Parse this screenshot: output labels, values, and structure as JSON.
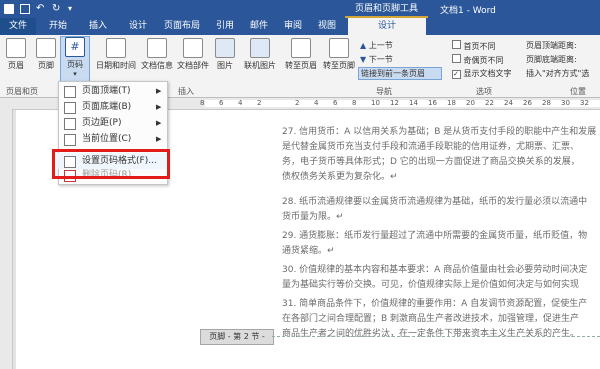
{
  "window": {
    "title": "文档1 - Word"
  },
  "context_group": "页眉和页脚工具",
  "tabs": [
    "文件",
    "开始",
    "插入",
    "设计",
    "页面布局",
    "引用",
    "邮件",
    "审阅",
    "视图",
    "设计"
  ],
  "ribbon": {
    "buttons": {
      "header": "页眉",
      "footer": "页脚",
      "page_number": "页码",
      "datetime": "日期和时间",
      "docinfo": "文档信息",
      "docparts": "文档部件",
      "picture": "图片",
      "online_picture": "联机图片",
      "goto_header": "转至页眉",
      "goto_footer": "转至页脚",
      "prev": "上一节",
      "next": "下一节",
      "link_prev": "链接到前一条页眉",
      "diff_first": "首页不同",
      "diff_odd_even": "奇偶页不同",
      "show_doc_text": "显示文档文字",
      "header_top": "页眉顶端距离:",
      "footer_bottom": "页脚底端距离:",
      "insert_align_tab": "插入\"对齐方式\"选"
    },
    "groups": {
      "header_footer": "页眉和页",
      "insert": "插入",
      "navigation": "导航",
      "options": "选项",
      "position": "位置"
    }
  },
  "menu": {
    "items": [
      {
        "label": "页面顶端(T)",
        "submenu": true
      },
      {
        "label": "页面底端(B)",
        "submenu": true
      },
      {
        "label": "页边距(P)",
        "submenu": true
      },
      {
        "label": "当前位置(C)",
        "submenu": true
      },
      {
        "label": "设置页码格式(F)...",
        "submenu": false
      },
      {
        "label": "删除页码(R)",
        "submenu": false
      }
    ]
  },
  "ruler_ticks": [
    "8",
    "6",
    "4",
    "2",
    "",
    "2",
    "4",
    "6",
    "8",
    "10",
    "12",
    "14",
    "16",
    "18",
    "20",
    "22",
    "24",
    "26",
    "28",
    "30",
    "32"
  ],
  "document": {
    "paragraphs": [
      "27. 信用货币：A 以信用关系为基础；B 是从货币支付手段的职能中产生和发展\n是代替金属货币充当支付手段和流通手段职能的信用证券，尤期票、汇票、\n务，电子货币等具体形式；D 它的出现一方面促进了商品交换关系的发展，\n债权债务关系更为复杂化。↵",
      "28. 纸币流通规律要以金属货币流通规律为基础，纸币的发行量必须以流通中\n货币量为限。↵",
      "29. 通货膨胀：纸币发行量超过了流通中所需要的金属货币量，纸币贬值，物\n通货紧缩。↵",
      "30. 价值规律的基本内容和基本要求：A 商品价值量由社会必要劳动时间决定\n量为基础实行等价交换。可见，价值规律实际上是价值如何决定与如何实现",
      "31. 简单商品条件下，价值规律的重要作用：A 自发调节资源配置，促使生产\n在各部门之间合理配置；B 刺激商品生产者改进技术，加强管理，促进生产\n商品生产者之间的优胜劣汰，在一定条件下带来资本主义生产关系的产生。"
    ],
    "footer_label": "页脚 - 第 2 节 -"
  },
  "colors": {
    "accent": "#2b579a",
    "highlight": "#e21b1b",
    "context_gold": "#d3a536"
  }
}
